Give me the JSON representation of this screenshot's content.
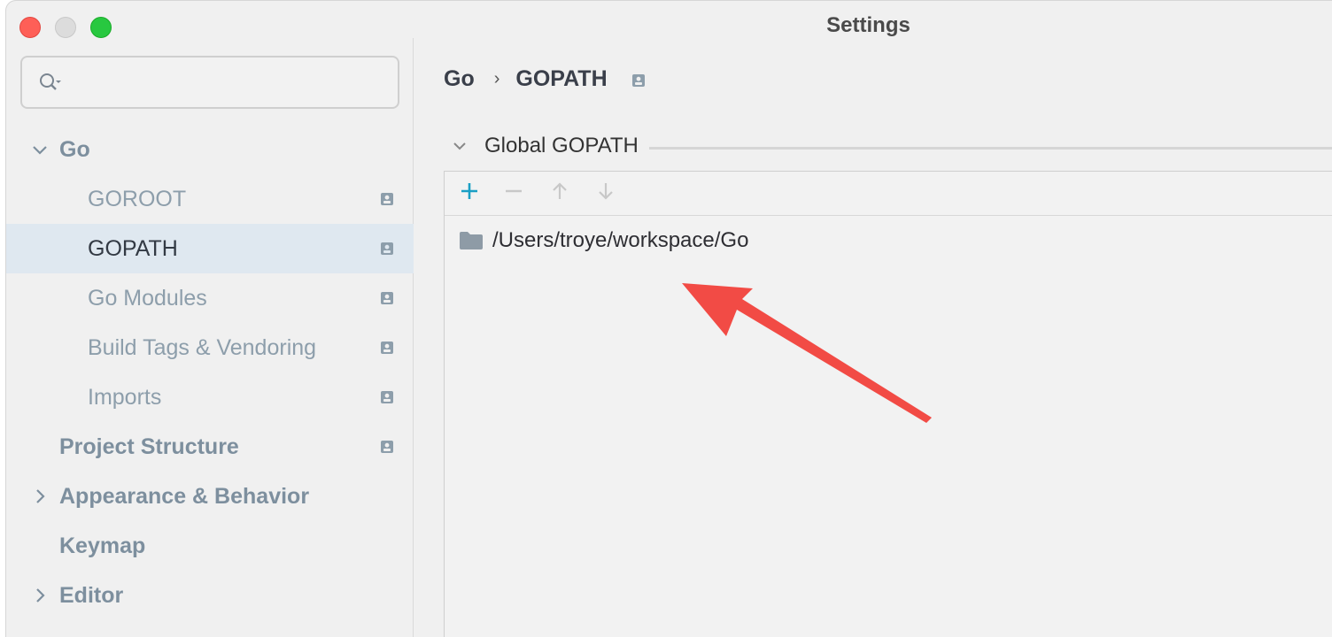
{
  "window": {
    "title": "Settings",
    "controls": [
      "close",
      "minimize",
      "maximize"
    ]
  },
  "sidebar": {
    "search": {
      "placeholder": "",
      "icon": "search-icon"
    },
    "items": [
      {
        "label": "Go",
        "level": "top",
        "expanded": true
      },
      {
        "label": "GOROOT",
        "level": "sub",
        "project_icon": true
      },
      {
        "label": "GOPATH",
        "level": "sub",
        "project_icon": true,
        "selected": true
      },
      {
        "label": "Go Modules",
        "level": "sub",
        "project_icon": true
      },
      {
        "label": "Build Tags & Vendoring",
        "level": "sub",
        "project_icon": true
      },
      {
        "label": "Imports",
        "level": "sub",
        "project_icon": true
      },
      {
        "label": "Project Structure",
        "level": "top",
        "project_icon": true
      },
      {
        "label": "Appearance & Behavior",
        "level": "top",
        "expanded": false
      },
      {
        "label": "Keymap",
        "level": "top"
      },
      {
        "label": "Editor",
        "level": "top",
        "expanded": false
      }
    ]
  },
  "main": {
    "breadcrumb": [
      "Go",
      "GOPATH"
    ],
    "section": {
      "title": "Global GOPATH",
      "expanded": true
    },
    "toolbar": [
      "add-icon",
      "remove-icon",
      "move-up-icon",
      "move-down-icon"
    ],
    "paths": [
      "/Users/troye/workspace/Go"
    ]
  },
  "colors": {
    "accent": "#1a9fc5",
    "selection": "#dfe8f0",
    "annotation_arrow": "#f24b45"
  }
}
